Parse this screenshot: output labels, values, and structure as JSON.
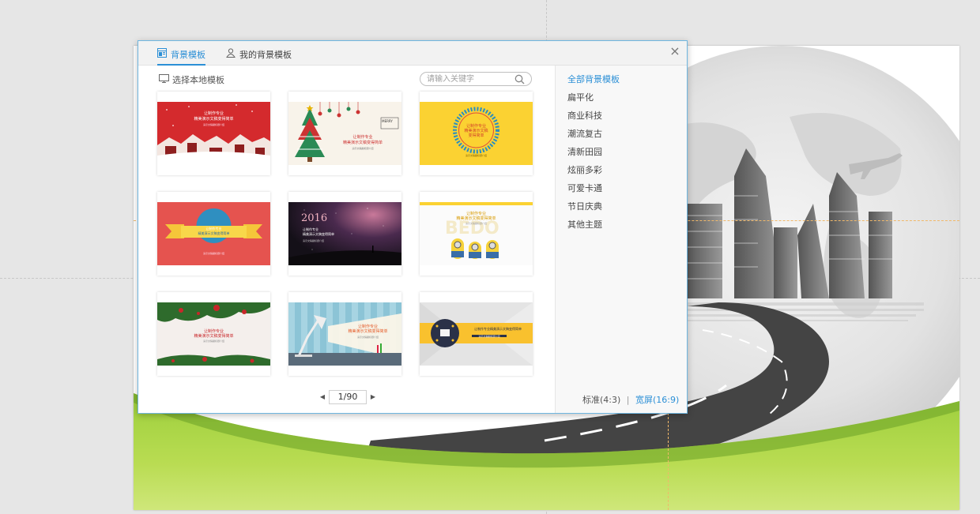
{
  "dialog": {
    "tabs": [
      {
        "label": "背景模板",
        "icon": "template-icon",
        "active": true
      },
      {
        "label": "我的背景模板",
        "icon": "user-icon",
        "active": false
      }
    ],
    "close_label": "×",
    "local_template_label": "选择本地模板",
    "search_placeholder": "请输入关键字",
    "templates": [
      {
        "theme": "red-christmas-village",
        "title1": "让制作专业",
        "title2": "精美演示文稿变得简单",
        "sub": "演示文稿副标题介绍"
      },
      {
        "theme": "christmas-tree",
        "badge": "MERRY",
        "title1": "让制作专业",
        "title2": "精美演示文稿变得简单",
        "sub": "演示文稿副标题介绍"
      },
      {
        "theme": "yellow-circle",
        "title1": "让制作专业",
        "title2": "精美演示文稿",
        "title3": "变得简单",
        "sub": "演示文稿副标题介绍"
      },
      {
        "theme": "ribbon-red",
        "title1": "让制作专业",
        "title2": "精美演示文稿变得简单",
        "sub": "演示文稿副标题介绍"
      },
      {
        "theme": "starry-night",
        "year": "2016",
        "title1": "让制作专业",
        "title2": "精美演示文稿变得简单",
        "sub": "演示文稿副标题介绍"
      },
      {
        "theme": "minions",
        "title1": "让制作专业",
        "title2": "精美演示文稿变得简单",
        "sub": "演示文稿副标题介绍"
      },
      {
        "theme": "christmas-wreath",
        "title1": "让制作专业",
        "title2": "精美演示文稿变得简单",
        "sub": "演示文稿副标题介绍"
      },
      {
        "theme": "desk-lamp",
        "title1": "让制作专业",
        "title2": "精美演示文稿变得简单",
        "sub": "演示文稿副标题介绍"
      },
      {
        "theme": "yellow-band",
        "title1": "让制作专业精美演示文稿变得简单",
        "sub": "演示文稿副标题介绍"
      }
    ],
    "pager": {
      "prev": "◀",
      "current": "1/90",
      "next": "▶"
    },
    "categories": [
      {
        "label": "全部背景模板",
        "active": true
      },
      {
        "label": "扁平化",
        "active": false
      },
      {
        "label": "商业科技",
        "active": false
      },
      {
        "label": "潮流复古",
        "active": false
      },
      {
        "label": "清新田园",
        "active": false
      },
      {
        "label": "炫丽多彩",
        "active": false
      },
      {
        "label": "可爱卡通",
        "active": false
      },
      {
        "label": "节日庆典",
        "active": false
      },
      {
        "label": "其他主题",
        "active": false
      }
    ],
    "aspect": {
      "standard": "标准(4:3)",
      "separator": "|",
      "wide": "宽屏(16:9)",
      "selected": "wide"
    }
  },
  "colors": {
    "accent": "#2b8fd6",
    "dialog_border": "#6fb6e0"
  }
}
